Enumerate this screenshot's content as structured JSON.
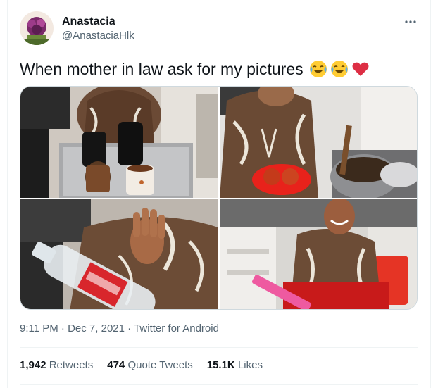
{
  "user": {
    "name": "Anastacia",
    "handle": "@AnastaciaHlk"
  },
  "tweet": {
    "text": "When mother in law ask for my pictures",
    "emojis": [
      "face-with-tears-of-joy-icon",
      "face-with-tears-of-joy-icon",
      "red-heart-icon"
    ]
  },
  "media": {
    "photos": [
      "photo-tray-with-flasks-and-mugs",
      "photo-cooking-at-stove-with-tomatoes",
      "photo-hand-raised-with-bottle",
      "photo-smiling-with-pink-tablet"
    ]
  },
  "meta": {
    "time": "9:11 PM",
    "date": "Dec 7, 2021",
    "source": "Twitter for Android",
    "sep": "·"
  },
  "stats": {
    "retweets_count": "1,942",
    "retweets_label": "Retweets",
    "quotes_count": "474",
    "quotes_label": "Quote Tweets",
    "likes_count": "15.1K",
    "likes_label": "Likes"
  },
  "colors": {
    "text": "#0f1419",
    "secondary": "#536471",
    "border": "#eff3f4",
    "heart": "#e0245e"
  }
}
